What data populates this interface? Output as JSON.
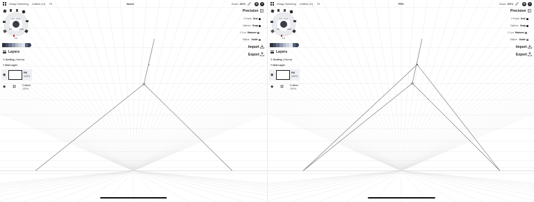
{
  "panes": [
    {
      "topbar": {
        "app": "Design Sketching",
        "doc": "Untitled (11)",
        "fit": "Fit",
        "status": "Saved",
        "zoom_label": "Zoom:",
        "zoom_value": "100%"
      },
      "layers": {
        "title": "Layers",
        "sorting_label": "Sorting",
        "sorting_value": "Manual",
        "new_layer": "+ New Layer",
        "items": [
          {
            "name": "Fill",
            "opacity": "100%"
          },
          {
            "name": "Custom",
            "opacity": "100%"
          }
        ]
      },
      "wheel": {
        "size_label": "14 × 14 px",
        "value_center": "5",
        "left": "0%",
        "right": "100%",
        "bottom": "8 px"
      },
      "precision": {
        "title": "Precision",
        "rows": [
          {
            "left": "3 Points",
            "right": "Grid"
          },
          {
            "left": "Options",
            "right": "Snap"
          },
          {
            "left": "1:1 px",
            "right": "Measure"
          },
          {
            "left": "Ellipse",
            "right": "Guide"
          }
        ]
      },
      "import_label": "Import",
      "export_label": "Export"
    },
    {
      "topbar": {
        "app": "Design Sketching",
        "doc": "Untitled (11)",
        "fit": "Fit",
        "status": "PRO",
        "zoom_label": "Zoom:",
        "zoom_value": "100%"
      },
      "layers": {
        "title": "Layers",
        "sorting_label": "Sorting",
        "sorting_value": "Manual",
        "new_layer": "+ New Layer",
        "items": [
          {
            "name": "Fill",
            "opacity": "100%"
          },
          {
            "name": "Custom",
            "opacity": "100%"
          }
        ]
      },
      "wheel": {
        "size_label": "14 × 14 px",
        "value_center": "5",
        "left": "0%",
        "right": "100%",
        "bottom": "8 px"
      },
      "precision": {
        "title": "Precision",
        "rows": [
          {
            "left": "3 Points",
            "right": "Grid"
          },
          {
            "left": "Options",
            "right": "Snap"
          },
          {
            "left": "1:1 px",
            "right": "Measure"
          },
          {
            "left": "Ellipse",
            "right": "Guide"
          }
        ]
      },
      "import_label": "Import",
      "export_label": "Export"
    }
  ],
  "colors": {
    "swatches": [
      "#2f3340",
      "#4a5064",
      "#6b7287",
      "#8f97ab",
      "#b2b9c9",
      "#cdd3de",
      "#e1e5ec",
      "#5a6480",
      "#3a4258"
    ]
  }
}
